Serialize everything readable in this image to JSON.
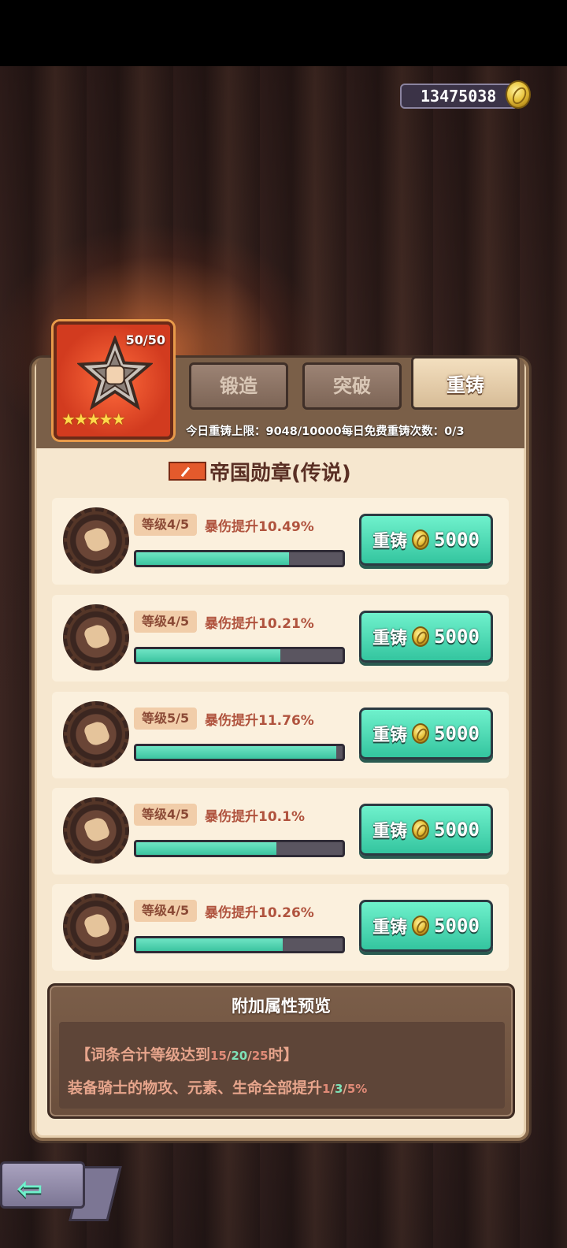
{
  "header": {
    "gold_amount": "13475038",
    "gold_icon": "gold-coin-icon"
  },
  "equipment": {
    "level_text": "50/50",
    "stars": 5,
    "stars_text": "★★★★★",
    "icon": "fist-medal-icon"
  },
  "tabs": [
    {
      "label": "锻造"
    },
    {
      "label": "突破"
    },
    {
      "label": "重铸"
    }
  ],
  "active_tab": "重铸",
  "limit_line": "今日重铸上限：9048/10000每日免费重铸次数：0/3",
  "item_title": "帝国勋章(传说)",
  "affixes": [
    {
      "level": "等级4/5",
      "stat": "暴伤提升10.49%",
      "progress": 0.74,
      "button_label": "重铸",
      "cost": "5000"
    },
    {
      "level": "等级4/5",
      "stat": "暴伤提升10.21%",
      "progress": 0.7,
      "button_label": "重铸",
      "cost": "5000"
    },
    {
      "level": "等级5/5",
      "stat": "暴伤提升11.76%",
      "progress": 0.97,
      "button_label": "重铸",
      "cost": "5000"
    },
    {
      "level": "等级4/5",
      "stat": "暴伤提升10.1%",
      "progress": 0.68,
      "button_label": "重铸",
      "cost": "5000"
    },
    {
      "level": "等级4/5",
      "stat": "暴伤提升10.26%",
      "progress": 0.71,
      "button_label": "重铸",
      "cost": "5000"
    }
  ],
  "preview": {
    "title": "附加属性预览",
    "cond_prefix": "【词条合计等级达到",
    "cond_v1": "15",
    "cond_v2": "20",
    "cond_v3": "25",
    "cond_suffix": "时】",
    "effect_prefix": "装备骑士的物攻、元素、生命全部提升",
    "effect_v1": "1",
    "effect_v2": "3",
    "effect_v3": "5%",
    "sep": "/"
  },
  "colors": {
    "accent_teal": "#3cc4a0",
    "panel_bg": "#f6e7cf",
    "stat_red": "#b0533e",
    "highlight_green": "#7fe3b8"
  }
}
